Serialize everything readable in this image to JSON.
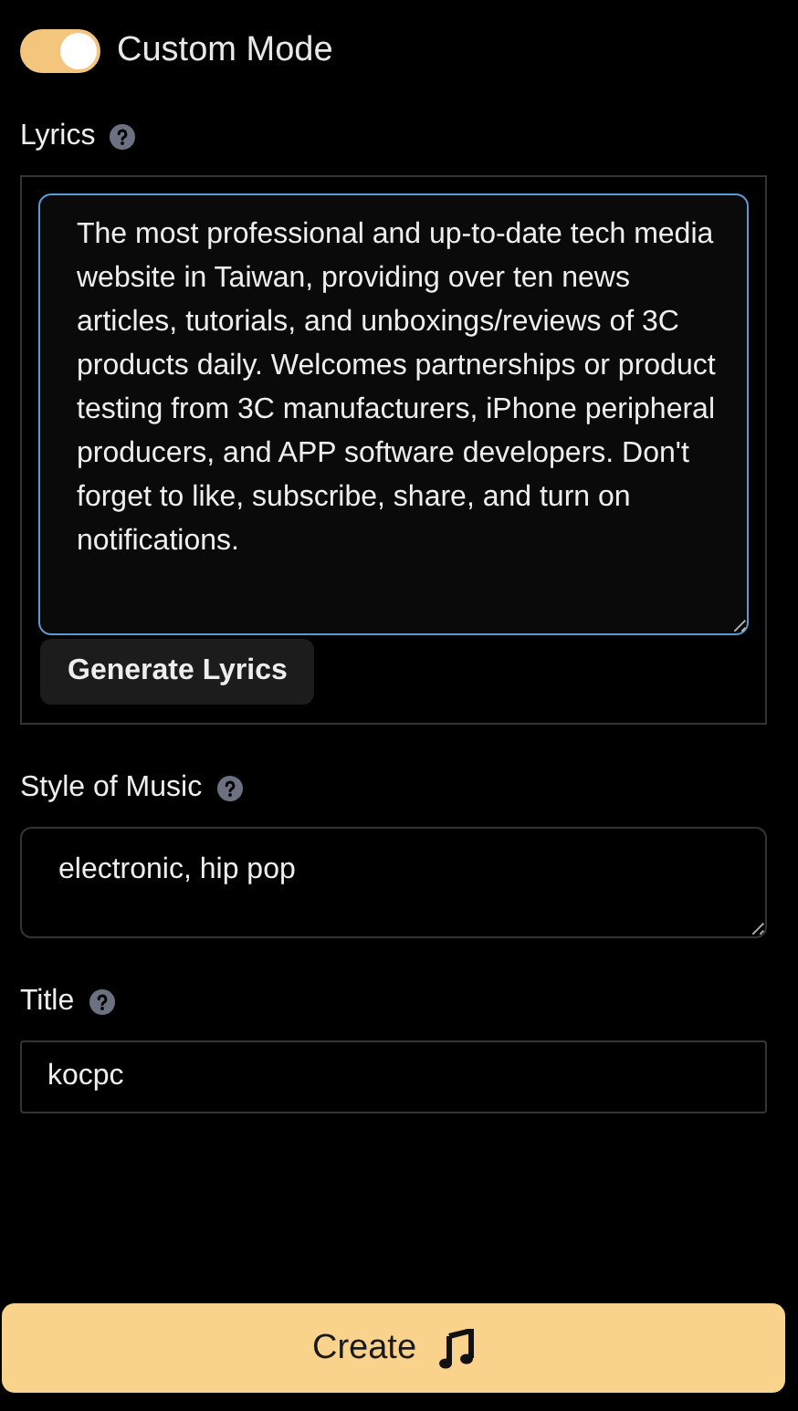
{
  "mode_toggle": {
    "label": "Custom Mode",
    "on": true
  },
  "lyrics": {
    "label": "Lyrics",
    "value": "The most professional and up-to-date tech media website in Taiwan, providing over ten news articles, tutorials, and unboxings/reviews of 3C products daily. Welcomes partnerships or product testing from 3C manufacturers, iPhone peripheral producers, and APP software developers. Don't forget to like, subscribe, share, and turn on notifications.",
    "button": "Generate Lyrics"
  },
  "style_of_music": {
    "label": "Style of Music",
    "value": "electronic, hip pop"
  },
  "title": {
    "label": "Title",
    "value": "kocpc"
  },
  "create_button": "Create"
}
